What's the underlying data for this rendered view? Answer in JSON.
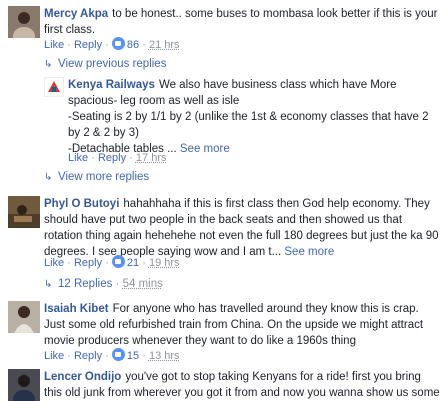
{
  "comments": [
    {
      "name": "Mercy Akpa",
      "text": "to be honest.. some buses to mombasa look better if this is your first class.",
      "like": "Like",
      "reply": "Reply",
      "reactions": "86",
      "time": "21 hrs"
    },
    {
      "name": "Phyl O Butoyi",
      "text": "hahahhaha if this is first class then God help economy. They should have put two people in the back seats and then showed us that rotation thing again hehehehe not even the full 180 degrees but just the ka 90 degrees. I see people saying wow and I am t...",
      "see_more": "See more",
      "like": "Like",
      "reply": "Reply",
      "reactions": "21",
      "time": "19 hrs"
    },
    {
      "name": "Isaiah Kibet",
      "text": "For anyone who has travelled around they know this is crap. Just some old refurbished train from China. On the upside we might attract movie producers whenever they want to do like a 1960s thing",
      "like": "Like",
      "reply": "Reply",
      "reactions": "15",
      "time": "13 hrs"
    },
    {
      "name": "Lencer Ondijo",
      "text": "you've got to stop taking Kenyans for a ride! first you bring this old junk from wherever you got it from and now you wanna show us some"
    }
  ],
  "view_previous_replies": "View previous replies",
  "reply_kr": {
    "name": "Kenya Railways",
    "line1": "We also have business class which have More spacious- leg room as well as isle",
    "line2": "-Seating is 2 by 1/1 by 2 (unlike the 1st & economy classes that have 2 by 2 & 2 by 3)",
    "line3": "-Detachable tables ...",
    "see_more": "See more",
    "like": "Like",
    "reply": "Reply",
    "time": "17 hrs"
  },
  "view_more_replies": "View more replies",
  "replies_12": "12 Replies",
  "replies_12_time": "54 mins",
  "colors": {
    "name_blue": "#365899",
    "link_blue": "#4267b2",
    "meta_gray": "#90949c",
    "like_badge": "#5890ff"
  }
}
